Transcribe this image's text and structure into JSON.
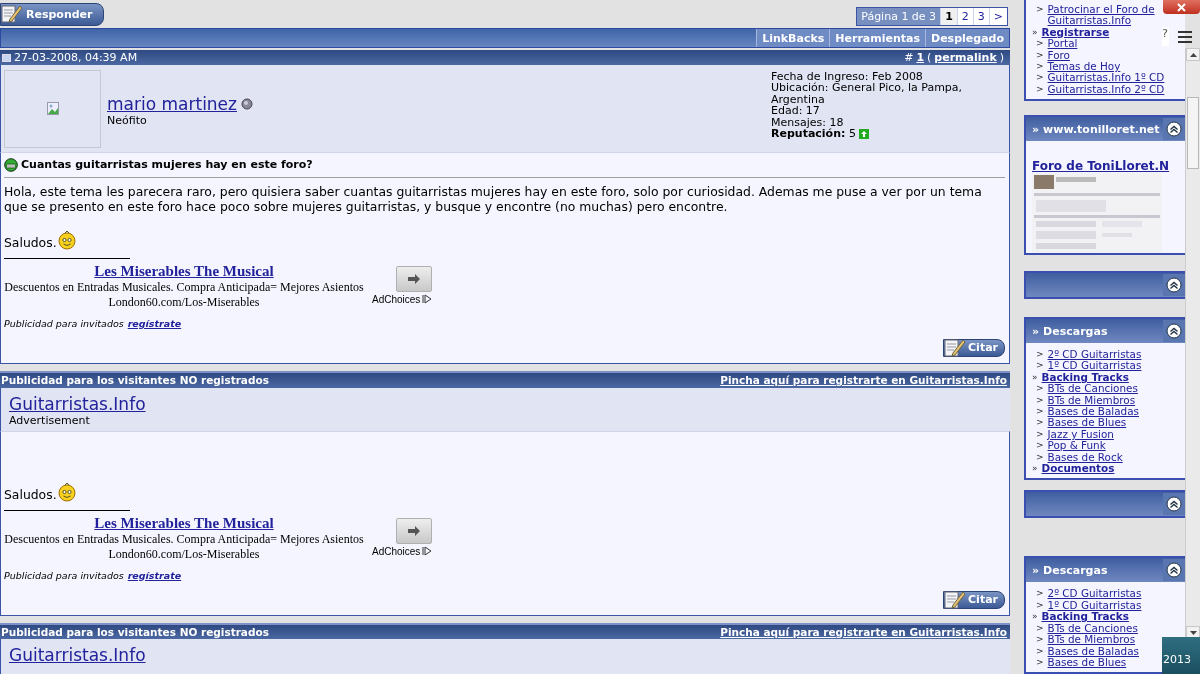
{
  "reply_button": "Responder",
  "pagination": {
    "label": "Página 1 de 3",
    "pages": [
      {
        "label": "1",
        "selected": true
      },
      {
        "label": "2",
        "selected": false
      },
      {
        "label": "3",
        "selected": false
      },
      {
        "label": ">",
        "selected": false
      }
    ]
  },
  "thread_tools": [
    "LinkBacks",
    "Herramientas",
    "Desplegado"
  ],
  "blocks": [
    {
      "kind": "post",
      "date": "27-03-2008, 04:39 AM",
      "number_prefix": "#",
      "number": "1",
      "paren_open": "(",
      "permalink": "permalink",
      "paren_close": ")",
      "author": "mario martinez",
      "rank": "Neófito",
      "user_info": [
        "Fecha de Ingreso: Feb 2008",
        "Ubicación: General Pico, la Pampa, Argentina",
        "Edad: 17",
        "Mensajes: 18"
      ],
      "reputation": "**Reputación:** 5",
      "title": "Cuantas guitarristas mujeres hay en este foro?",
      "message": "Hola, este tema les parecera raro, pero quisiera saber cuantas guitarristas mujeres hay en este foro, solo por curiosidad. Ademas me puse a ver por un tema que se presento en este foro hace poco sobre mujeres guitarristas, y busque y encontre (no muchas) pero encontre.",
      "greeting": "Saludos.",
      "ad": {
        "title": "Les Miserables The Musical",
        "text": "Descuentos en Entradas Musicales. Compra Anticipada= Mejores Asientos",
        "url": "London60.com/Los-Miserables",
        "adchoices": "AdChoices"
      },
      "guest_note": "Publicidad para invitados",
      "guest_link": "regístrate",
      "quote_button": "Citar"
    },
    {
      "kind": "guest_ad",
      "header": "Publicidad para los visitantes NO registrados",
      "register_link": "Pincha aquí para registrarte en Guitarristas.Info",
      "site": "Guitarristas.Info",
      "site_label": "Advertisement",
      "greeting": "Saludos.",
      "ad": {
        "title": "Les Miserables The Musical",
        "text": "Descuentos en Entradas Musicales. Compra Anticipada= Mejores Asientos",
        "url": "London60.com/Los-Miserables",
        "adchoices": "AdChoices"
      },
      "guest_note": "Publicidad para invitados",
      "guest_link": "regístrate",
      "quote_button": "Citar"
    },
    {
      "kind": "guest_ad",
      "header": "Publicidad para los visitantes NO registrados",
      "register_link": "Pincha aquí para registrarte en Guitarristas.Info",
      "site": "Guitarristas.Info"
    }
  ],
  "sidebar": [
    {
      "kind": "links",
      "items": [
        {
          "kind": "link",
          "marker": ">",
          "text": "Patrocinar el Foro de Guitarristas.Info"
        },
        {
          "kind": "section",
          "marker": "»",
          "text": "Registrarse"
        },
        {
          "kind": "link",
          "marker": ">",
          "text": "Portal"
        },
        {
          "kind": "link",
          "marker": ">",
          "text": "Foro"
        },
        {
          "kind": "link",
          "marker": ">",
          "text": "Temas de Hoy"
        },
        {
          "kind": "link",
          "marker": ">",
          "text": "Guitarristas.Info 1º CD"
        },
        {
          "kind": "link",
          "marker": ">",
          "text": "Guitarristas.Info 2º CD"
        }
      ]
    },
    {
      "kind": "feature",
      "marker": "»",
      "title": "www.tonilloret.net",
      "link": "Foro de ToniLloret.N"
    },
    {
      "kind": "collapsed"
    },
    {
      "kind": "links",
      "marker": "»",
      "title": "Descargas",
      "items": [
        {
          "kind": "link",
          "marker": ">",
          "text": "2º CD Guitarristas"
        },
        {
          "kind": "link",
          "marker": ">",
          "text": "1º CD Guitarristas"
        },
        {
          "kind": "section",
          "marker": "»",
          "text": "Backing Tracks"
        },
        {
          "kind": "link",
          "marker": ">",
          "text": "BTs de Canciones"
        },
        {
          "kind": "link",
          "marker": ">",
          "text": "BTs de Miembros"
        },
        {
          "kind": "link",
          "marker": ">",
          "text": "Bases de Baladas"
        },
        {
          "kind": "link",
          "marker": ">",
          "text": "Bases de Blues"
        },
        {
          "kind": "link",
          "marker": ">",
          "text": "Jazz y Fusion"
        },
        {
          "kind": "link",
          "marker": ">",
          "text": "Pop & Funk"
        },
        {
          "kind": "link",
          "marker": ">",
          "text": "Bases de Rock"
        },
        {
          "kind": "section",
          "marker": "»",
          "text": "Documentos"
        }
      ]
    },
    {
      "kind": "collapsed"
    },
    {
      "kind": "links",
      "marker": "»",
      "title": "Descargas",
      "items": [
        {
          "kind": "link",
          "marker": ">",
          "text": "2º CD Guitarristas"
        },
        {
          "kind": "link",
          "marker": ">",
          "text": "1º CD Guitarristas"
        },
        {
          "kind": "section",
          "marker": "»",
          "text": "Backing Tracks"
        },
        {
          "kind": "link",
          "marker": ">",
          "text": "BTs de Canciones"
        },
        {
          "kind": "link",
          "marker": ">",
          "text": "BTs de Miembros"
        },
        {
          "kind": "link",
          "marker": ">",
          "text": "Bases de Baladas"
        },
        {
          "kind": "link",
          "marker": ">",
          "text": "Bases de Blues"
        }
      ]
    }
  ],
  "browser": {
    "help_text": "?"
  },
  "taskbar": {
    "clock": "2013"
  }
}
